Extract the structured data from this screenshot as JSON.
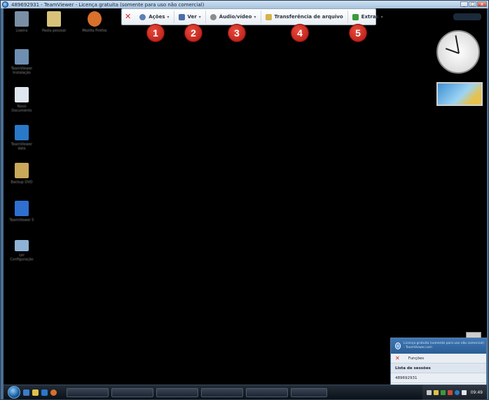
{
  "window": {
    "title": "489692931 - TeamViewer - Licença gratuita (somente para uso não comercial)",
    "controls": [
      "_",
      "□",
      "x"
    ]
  },
  "toolbar": {
    "close_glyph": "✕",
    "items": [
      {
        "label": "Ações",
        "icon": "actions-icon",
        "caret": "▾",
        "color": "#5b7fb5"
      },
      {
        "label": "Ver",
        "icon": "view-icon",
        "caret": "▾",
        "color": "#4b6ea8"
      },
      {
        "label": "Áudio/vídeo",
        "icon": "audio-video-icon",
        "caret": "▾",
        "color": "#8c8c8c"
      },
      {
        "label": "Transferência de arquivo",
        "icon": "file-transfer-icon",
        "caret": "",
        "color": "#d6b34a"
      },
      {
        "label": "Extras",
        "icon": "extras-icon",
        "caret": "▾",
        "color": "#3a9a3a"
      }
    ]
  },
  "badges": [
    "1",
    "2",
    "3",
    "4",
    "5"
  ],
  "desktop_icons": [
    {
      "name": "recycle-bin-icon",
      "label": "Lixeira",
      "color": "#7a8ea6"
    },
    {
      "name": "folder-icon",
      "label": "Pasta pessoal",
      "color": "#d8c27a"
    },
    {
      "name": "firefox-icon",
      "label": "Mozilla Firefox",
      "color": "#d9702b"
    },
    {
      "name": "shortcut-icon",
      "label": "TeamViewer Instalação",
      "color": "#6e8fb2"
    },
    {
      "name": "document-icon",
      "label": "Novo Documento",
      "color": "#dfe6ee"
    },
    {
      "name": "teamviewer-icon",
      "label": "TeamViewer data",
      "color": "#2a78c8"
    },
    {
      "name": "program-icon",
      "label": "Backup DVD",
      "color": "#c9a85a"
    },
    {
      "name": "teamviewer-app-icon",
      "label": "TeamViewer 5",
      "color": "#2f6fd0"
    },
    {
      "name": "config-icon",
      "label": "Ler Configuração",
      "color": "#8fb3d6"
    }
  ],
  "tv_panel": {
    "header_text": "Licença gratuita (somente para uso não comercial) - TeamViewer.com",
    "close_glyph": "✕",
    "functions_label": "Funções",
    "sessions_label": "Lista de sessões",
    "session_id": "489692931"
  },
  "taskbar": {
    "time": "09:49"
  }
}
